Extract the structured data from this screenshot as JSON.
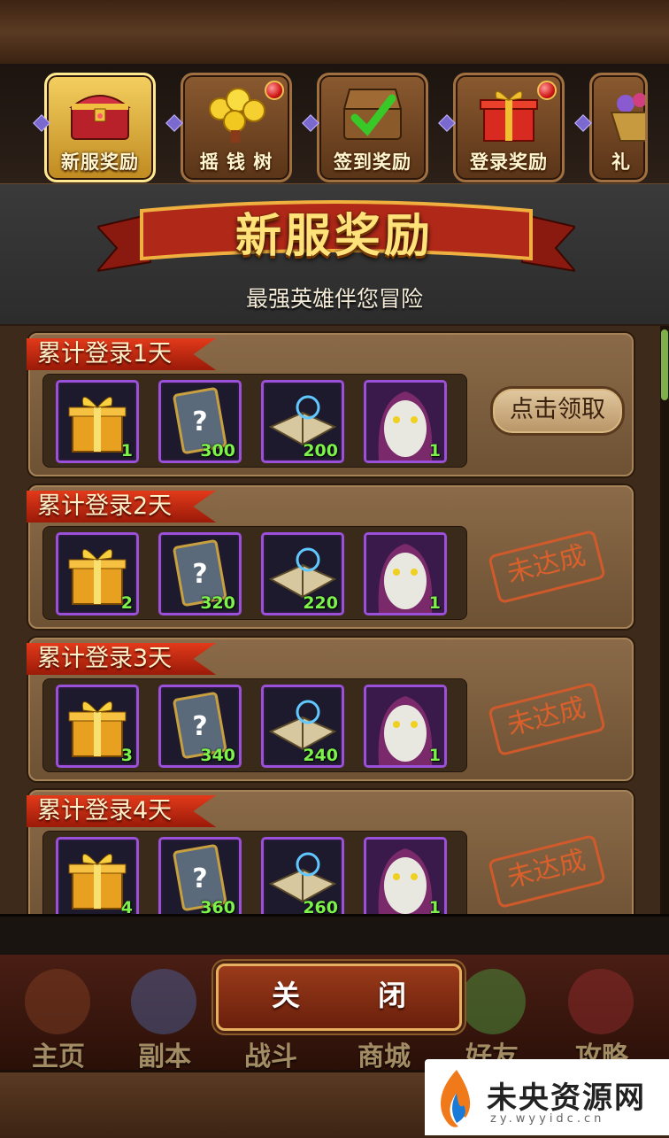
{
  "tabs": [
    {
      "label": "新服奖励",
      "icon": "treasure-chest-icon",
      "active": true,
      "badge": false
    },
    {
      "label": "摇 钱 树",
      "icon": "gold-coins-tree-icon",
      "active": false,
      "badge": true
    },
    {
      "label": "签到奖励",
      "icon": "check-chest-icon",
      "active": false,
      "badge": false
    },
    {
      "label": "登录奖励",
      "icon": "gift-box-icon",
      "active": false,
      "badge": true
    },
    {
      "label": "礼",
      "icon": "gem-bag-icon",
      "active": false,
      "badge": false
    }
  ],
  "banner": {
    "title": "新服奖励",
    "subtitle": "最强英雄伴您冒险"
  },
  "rewards": [
    {
      "title": "累计登录1天",
      "items": [
        "1",
        "300",
        "200",
        "1"
      ],
      "action": "点击领取",
      "claimable": true
    },
    {
      "title": "累计登录2天",
      "items": [
        "2",
        "320",
        "220",
        "1"
      ],
      "action": "未达成",
      "claimable": false
    },
    {
      "title": "累计登录3天",
      "items": [
        "3",
        "340",
        "240",
        "1"
      ],
      "action": "未达成",
      "claimable": false
    },
    {
      "title": "累计登录4天",
      "items": [
        "4",
        "360",
        "260",
        "1"
      ],
      "action": "未达成",
      "claimable": false
    }
  ],
  "item_icons": [
    "gold-gift-icon",
    "mystery-card-icon",
    "skill-book-icon",
    "masked-hero-icon"
  ],
  "close_label": "关　闭",
  "nav": [
    "主页",
    "副本",
    "战斗",
    "商城",
    "好友",
    "攻略"
  ],
  "watermark": {
    "name": "未央资源网",
    "url": "zy.wyyidc.cn"
  },
  "colors": {
    "quantity": "#7cf24a",
    "tag": "#e23a1a",
    "stamp": "#e2602a",
    "slot_border": "#9a50d8"
  }
}
